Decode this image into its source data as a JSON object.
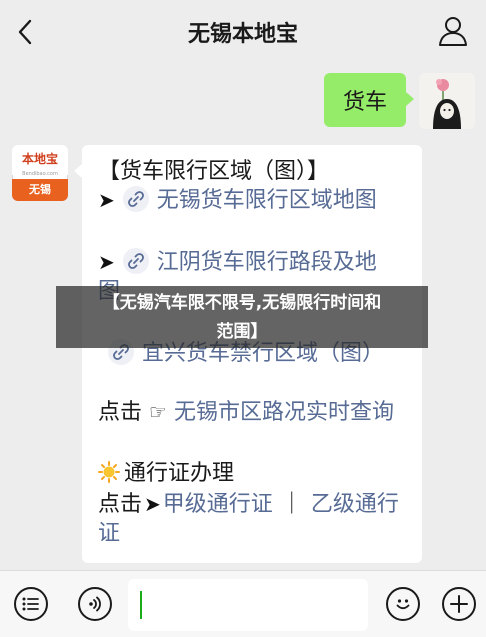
{
  "header": {
    "title": "无锡本地宝"
  },
  "chat": {
    "outgoing": {
      "text": "货车"
    },
    "account_avatar": {
      "top": "本地宝",
      "subtitle": "Bendibao.com",
      "bottom": "无锡"
    },
    "incoming": {
      "heading": "【货车限行区域（图）】",
      "links": [
        {
          "text": "无锡货车限行区域地图"
        },
        {
          "text": "江阴货车限行路段及地"
        },
        {
          "text": "图"
        },
        {
          "text": "宜兴货车禁行区域（图）"
        }
      ],
      "click_prefix": "点击",
      "click_link": "无锡市区路况实时查询",
      "permit_heading": "通行证办理",
      "permit_prefix": "点击",
      "permit_link_a": "甲级通行证",
      "permit_sep": "｜",
      "permit_link_b": "乙级通行",
      "permit_link_b2": "证"
    }
  },
  "overlay": {
    "line1": "【无锡汽车限不限号,无锡限行时间和",
    "line2": "范围】"
  },
  "icons": {
    "back": "chevron-left-icon",
    "profile": "person-icon",
    "list": "list-icon",
    "voice": "voice-icon",
    "emoji": "emoji-icon",
    "add": "plus-icon"
  },
  "colors": {
    "bubble_out": "#95ec69",
    "link": "#576b95",
    "brand": "#e8611f"
  }
}
